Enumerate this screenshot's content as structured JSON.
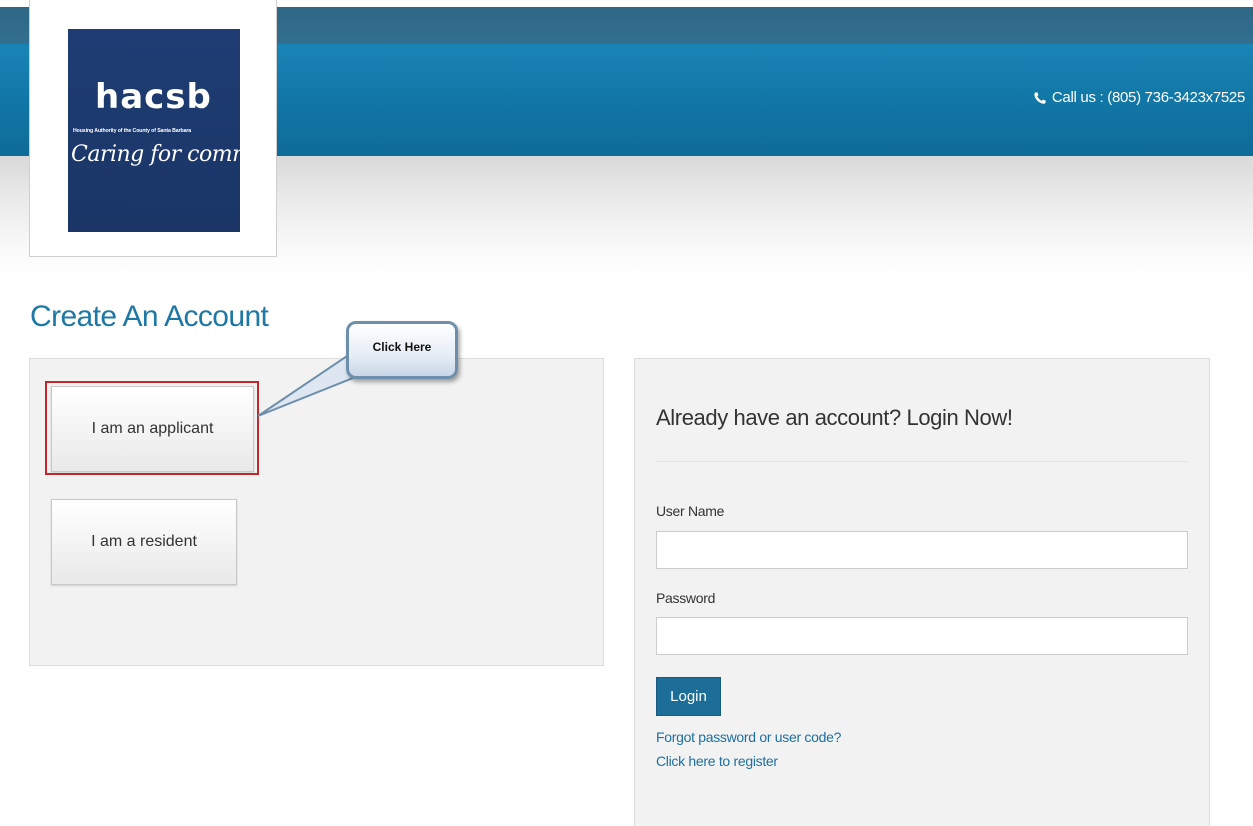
{
  "header": {
    "phone_text": "Call us : (805) 736-3423x7525",
    "phone_icon": "phone-icon",
    "colors": {
      "header_blue": "#1278a8",
      "header_dark": "#2e6584"
    }
  },
  "logo": {
    "mark": "hacsb",
    "subtitle": "Housing Authority of the County of Santa Barbara",
    "tagline": "Caring for community",
    "background": "#1f3d74"
  },
  "page": {
    "title": "Create An Account",
    "title_color": "#1e78a6"
  },
  "account_types": {
    "applicant_label": "I am an applicant",
    "resident_label": "I am a resident"
  },
  "callout": {
    "text": "Click Here",
    "highlight_color": "#c1272d"
  },
  "login": {
    "heading": "Already have an account? Login Now!",
    "username_label": "User Name",
    "username_value": "",
    "password_label": "Password",
    "password_value": "",
    "button_label": "Login",
    "forgot_link": "Forgot password or user code?",
    "register_link": "Click here to register",
    "accent": "#1c6e98"
  }
}
